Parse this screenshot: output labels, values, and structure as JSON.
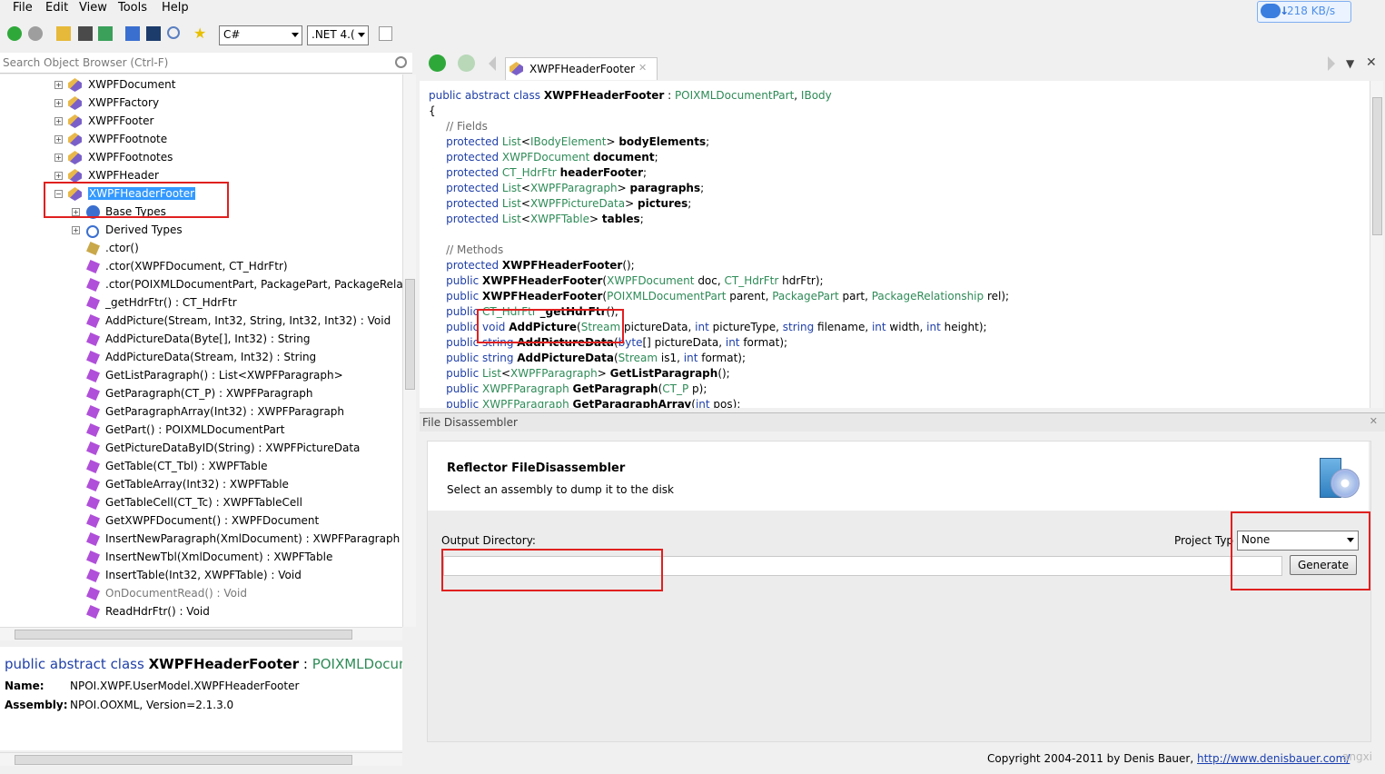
{
  "menu": [
    "File",
    "Edit",
    "View",
    "Tools",
    "Help"
  ],
  "speed": "218 KB/s",
  "toolbar": {
    "language": "C#",
    "framework": ".NET 4.("
  },
  "search": {
    "placeholder": "Search Object Browser (Ctrl-F)"
  },
  "tree": [
    {
      "label": "XWPFDocument",
      "kind": "class",
      "expander": "+"
    },
    {
      "label": "XWPFFactory",
      "kind": "class",
      "expander": "+"
    },
    {
      "label": "XWPFFooter",
      "kind": "class",
      "expander": "+"
    },
    {
      "label": "XWPFFootnote",
      "kind": "class",
      "expander": "+"
    },
    {
      "label": "XWPFFootnotes",
      "kind": "class",
      "expander": "+"
    },
    {
      "label": "XWPFHeader",
      "kind": "class",
      "expander": "+"
    },
    {
      "label": "XWPFHeaderFooter",
      "kind": "class",
      "expander": "-",
      "selected": true
    },
    {
      "label": "Base Types",
      "kind": "base",
      "expander": "+"
    },
    {
      "label": "Derived Types",
      "kind": "derived",
      "expander": "+"
    },
    {
      "label": ".ctor()",
      "kind": "ctor"
    },
    {
      "label": ".ctor(XWPFDocument, CT_HdrFtr)",
      "kind": "method"
    },
    {
      "label": ".ctor(POIXMLDocumentPart, PackagePart, PackageRelati",
      "kind": "method"
    },
    {
      "label": "_getHdrFtr() : CT_HdrFtr",
      "kind": "method"
    },
    {
      "label": "AddPicture(Stream, Int32, String, Int32, Int32) : Void",
      "kind": "method"
    },
    {
      "label": "AddPictureData(Byte[], Int32) : String",
      "kind": "method"
    },
    {
      "label": "AddPictureData(Stream, Int32) : String",
      "kind": "method"
    },
    {
      "label": "GetListParagraph() : List<XWPFParagraph>",
      "kind": "method"
    },
    {
      "label": "GetParagraph(CT_P) : XWPFParagraph",
      "kind": "method"
    },
    {
      "label": "GetParagraphArray(Int32) : XWPFParagraph",
      "kind": "method"
    },
    {
      "label": "GetPart() : POIXMLDocumentPart",
      "kind": "method"
    },
    {
      "label": "GetPictureDataByID(String) : XWPFPictureData",
      "kind": "method"
    },
    {
      "label": "GetTable(CT_Tbl) : XWPFTable",
      "kind": "method"
    },
    {
      "label": "GetTableArray(Int32) : XWPFTable",
      "kind": "method"
    },
    {
      "label": "GetTableCell(CT_Tc) : XWPFTableCell",
      "kind": "method"
    },
    {
      "label": "GetXWPFDocument() : XWPFDocument",
      "kind": "method"
    },
    {
      "label": "InsertNewParagraph(XmlDocument) : XWPFParagraph",
      "kind": "method"
    },
    {
      "label": "InsertNewTbl(XmlDocument) : XWPFTable",
      "kind": "method"
    },
    {
      "label": "InsertTable(Int32, XWPFTable) : Void",
      "kind": "method"
    },
    {
      "label": "OnDocumentRead() : Void",
      "kind": "method",
      "muted": true
    },
    {
      "label": "ReadHdrFtr() : Void",
      "kind": "method"
    }
  ],
  "info": {
    "decl_kw": "public abstract class",
    "decl_name": "XWPFHeaderFooter",
    "decl_sep": " : ",
    "decl_base": "POIXMLDocumen",
    "name_label": "Name:",
    "name_value": "NPOI.XWPF.UserModel.XWPFHeaderFooter",
    "assembly_label": "Assembly:",
    "assembly_value": "NPOI.OOXML, Version=2.1.3.0"
  },
  "doc_tab": "XWPFHeaderFooter",
  "code": [
    [
      {
        "t": "public abstract class ",
        "c": "kw"
      },
      {
        "t": "XWPFHeaderFooter",
        "c": "bold"
      },
      {
        "t": " : "
      },
      {
        "t": "POIXMLDocumentPart",
        "c": "ty"
      },
      {
        "t": ", "
      },
      {
        "t": "IBody",
        "c": "ty"
      }
    ],
    [
      {
        "t": "{"
      }
    ],
    [
      {
        "t": "    // Fields",
        "c": "cm"
      }
    ],
    [
      {
        "t": "    protected ",
        "c": "kw"
      },
      {
        "t": "List",
        "c": "ty"
      },
      {
        "t": "<"
      },
      {
        "t": "IBodyElement",
        "c": "ty"
      },
      {
        "t": "> "
      },
      {
        "t": "bodyElements",
        "c": "bold"
      },
      {
        "t": ";"
      }
    ],
    [
      {
        "t": "    protected ",
        "c": "kw"
      },
      {
        "t": "XWPFDocument",
        "c": "ty"
      },
      {
        "t": " "
      },
      {
        "t": "document",
        "c": "bold"
      },
      {
        "t": ";"
      }
    ],
    [
      {
        "t": "    protected ",
        "c": "kw"
      },
      {
        "t": "CT_HdrFtr",
        "c": "ty"
      },
      {
        "t": " "
      },
      {
        "t": "headerFooter",
        "c": "bold"
      },
      {
        "t": ";"
      }
    ],
    [
      {
        "t": "    protected ",
        "c": "kw"
      },
      {
        "t": "List",
        "c": "ty"
      },
      {
        "t": "<"
      },
      {
        "t": "XWPFParagraph",
        "c": "ty"
      },
      {
        "t": "> "
      },
      {
        "t": "paragraphs",
        "c": "bold"
      },
      {
        "t": ";"
      }
    ],
    [
      {
        "t": "    protected ",
        "c": "kw"
      },
      {
        "t": "List",
        "c": "ty"
      },
      {
        "t": "<"
      },
      {
        "t": "XWPFPictureData",
        "c": "ty"
      },
      {
        "t": "> "
      },
      {
        "t": "pictures",
        "c": "bold"
      },
      {
        "t": ";"
      }
    ],
    [
      {
        "t": "    protected ",
        "c": "kw"
      },
      {
        "t": "List",
        "c": "ty"
      },
      {
        "t": "<"
      },
      {
        "t": "XWPFTable",
        "c": "ty"
      },
      {
        "t": "> "
      },
      {
        "t": "tables",
        "c": "bold"
      },
      {
        "t": ";"
      }
    ],
    [
      {
        "t": ""
      }
    ],
    [
      {
        "t": "    // Methods",
        "c": "cm"
      }
    ],
    [
      {
        "t": "    protected ",
        "c": "kw"
      },
      {
        "t": "XWPFHeaderFooter",
        "c": "bold"
      },
      {
        "t": "();"
      }
    ],
    [
      {
        "t": "    public ",
        "c": "kw"
      },
      {
        "t": "XWPFHeaderFooter",
        "c": "bold"
      },
      {
        "t": "("
      },
      {
        "t": "XWPFDocument",
        "c": "ty"
      },
      {
        "t": " doc, "
      },
      {
        "t": "CT_HdrFtr",
        "c": "ty"
      },
      {
        "t": " hdrFtr);"
      }
    ],
    [
      {
        "t": "    public ",
        "c": "kw"
      },
      {
        "t": "XWPFHeaderFooter",
        "c": "bold"
      },
      {
        "t": "("
      },
      {
        "t": "POIXMLDocumentPart",
        "c": "ty"
      },
      {
        "t": " parent, "
      },
      {
        "t": "PackagePart",
        "c": "ty"
      },
      {
        "t": " part, "
      },
      {
        "t": "PackageRelationship",
        "c": "ty"
      },
      {
        "t": " rel);"
      }
    ],
    [
      {
        "t": "    public ",
        "c": "kw"
      },
      {
        "t": "CT_HdrFtr",
        "c": "ty"
      },
      {
        "t": " "
      },
      {
        "t": "_getHdrFtr",
        "c": "bold"
      },
      {
        "t": "();"
      }
    ],
    [
      {
        "t": "    public ",
        "c": "kw"
      },
      {
        "t": "void ",
        "c": "kw"
      },
      {
        "t": "AddPicture",
        "c": "bold"
      },
      {
        "t": "("
      },
      {
        "t": "Stream",
        "c": "ty"
      },
      {
        "t": " pictureData, "
      },
      {
        "t": "int",
        "c": "kw"
      },
      {
        "t": " pictureType, "
      },
      {
        "t": "string",
        "c": "kw"
      },
      {
        "t": " filename, "
      },
      {
        "t": "int",
        "c": "kw"
      },
      {
        "t": " width, "
      },
      {
        "t": "int",
        "c": "kw"
      },
      {
        "t": " height);"
      }
    ],
    [
      {
        "t": "    public ",
        "c": "kw"
      },
      {
        "t": "string ",
        "c": "kw"
      },
      {
        "t": "AddPictureData",
        "c": "bold"
      },
      {
        "t": "("
      },
      {
        "t": "byte",
        "c": "kw"
      },
      {
        "t": "[] pictureData, "
      },
      {
        "t": "int",
        "c": "kw"
      },
      {
        "t": " format);"
      }
    ],
    [
      {
        "t": "    public ",
        "c": "kw"
      },
      {
        "t": "string ",
        "c": "kw"
      },
      {
        "t": "AddPictureData",
        "c": "bold"
      },
      {
        "t": "("
      },
      {
        "t": "Stream",
        "c": "ty"
      },
      {
        "t": " is1, "
      },
      {
        "t": "int",
        "c": "kw"
      },
      {
        "t": " format);"
      }
    ],
    [
      {
        "t": "    public ",
        "c": "kw"
      },
      {
        "t": "List",
        "c": "ty"
      },
      {
        "t": "<"
      },
      {
        "t": "XWPFParagraph",
        "c": "ty"
      },
      {
        "t": "> "
      },
      {
        "t": "GetListParagraph",
        "c": "bold"
      },
      {
        "t": "();"
      }
    ],
    [
      {
        "t": "    public ",
        "c": "kw"
      },
      {
        "t": "XWPFParagraph",
        "c": "ty"
      },
      {
        "t": " "
      },
      {
        "t": "GetParagraph",
        "c": "bold"
      },
      {
        "t": "("
      },
      {
        "t": "CT_P",
        "c": "ty"
      },
      {
        "t": " p);"
      }
    ],
    [
      {
        "t": "    public ",
        "c": "kw"
      },
      {
        "t": "XWPFParagraph",
        "c": "ty"
      },
      {
        "t": " "
      },
      {
        "t": "GetParagraphArray",
        "c": "bold"
      },
      {
        "t": "("
      },
      {
        "t": "int",
        "c": "kw"
      },
      {
        "t": " pos);"
      }
    ]
  ],
  "disassembler": {
    "title": "File Disassembler",
    "header_title": "Reflector FileDisassembler",
    "header_sub": "Select an assembly to dump it to the disk",
    "output_label": "Output Directory:",
    "output_value": "",
    "project_label": "Project Typ",
    "project_value": "None",
    "generate_label": "Generate"
  },
  "footer": {
    "copyright_text": "Copyright 2004-2011 by Denis Bauer, ",
    "copyright_link": "http://www.denisbauer.com/",
    "watermark": "angxi"
  },
  "colors": {
    "highlight": "#e0201f",
    "selection": "#3399ff",
    "keyword": "#1f3fa8",
    "type": "#2e8b57"
  }
}
